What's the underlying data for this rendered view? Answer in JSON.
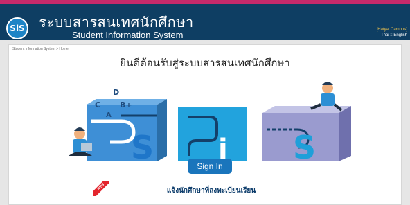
{
  "header": {
    "logo_text": "SiS",
    "title_th": "ระบบสารสนเทศนักศึกษา",
    "title_en": "Student Information System",
    "campus": "[Hatyai Campus]",
    "lang_thai": "Thai",
    "lang_sep": " :: ",
    "lang_english": "English"
  },
  "breadcrumb": "Student Information System > Home",
  "welcome": "ยินดีต้อนรับสู่ระบบสารสนเทศนักศึกษา",
  "signin_label": "Sign In",
  "notice": {
    "badge": "NEW",
    "text": "แจ้งนักศึกษาที่ลงทะเบียนเรียน"
  },
  "hero": {
    "letters": [
      "D",
      "C",
      "B+",
      "A"
    ],
    "panel_letters": [
      "S",
      "i",
      "S"
    ]
  },
  "colors": {
    "header_bg": "#0e3e63",
    "accent_stripe": "#c62a6b",
    "button": "#1a75bc",
    "campus": "#f6c84e"
  }
}
